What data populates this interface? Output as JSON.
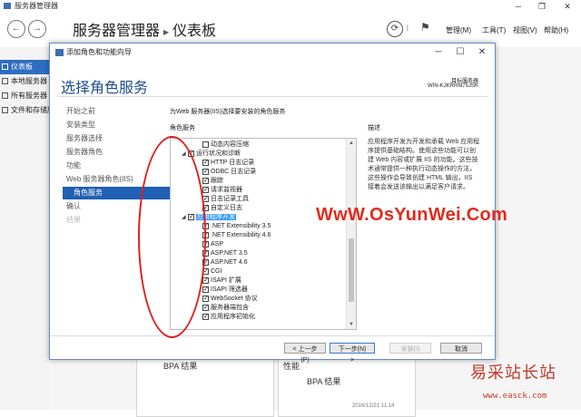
{
  "server_manager": {
    "window_title": "服务器管理器",
    "breadcrumb": {
      "app": "服务器管理器",
      "separator": "▸",
      "page": "仪表板"
    },
    "menus": {
      "manage": "管理(M)",
      "tools": "工具(T)",
      "view": "视图(V)",
      "help": "帮助(H)"
    },
    "nav": [
      "仪表板",
      "本地服务器",
      "所有服务器",
      "文件和存储服务"
    ],
    "tiles": {
      "left_bpa": "BPA 结果",
      "right_perf": "性能",
      "right_bpa": "BPA 结果",
      "timestamp": "2016/12/21 11:14"
    }
  },
  "wizard": {
    "title": "添加角色和功能向导",
    "heading": "选择角色服务",
    "dest_label": "目标服务器",
    "dest_server": "WIN-KJKRRM75JSK",
    "steps": [
      {
        "label": "开始之前",
        "state": "normal"
      },
      {
        "label": "安装类型",
        "state": "normal"
      },
      {
        "label": "服务器选择",
        "state": "normal"
      },
      {
        "label": "服务器角色",
        "state": "normal"
      },
      {
        "label": "功能",
        "state": "normal"
      },
      {
        "label": "Web 服务器角色(IIS)",
        "state": "normal"
      },
      {
        "label": "角色服务",
        "state": "active"
      },
      {
        "label": "确认",
        "state": "normal"
      },
      {
        "label": "结果",
        "state": "dim"
      }
    ],
    "intro": "为Web 服务器(IIS)选择要安装的角色服务",
    "roles_label": "角色服务",
    "desc_title": "描述",
    "description": "应用程序开发为开发和承载 Web 应用程序提供基础结构。使用这些功能可以创建 Web 内容或扩展 IIS 的功能。这些技术通常提供一种执行动态操作的方法，这些操作会导致创建 HTML 输出，IIS 接着会发送该输出以满足客户请求。",
    "tree": [
      {
        "label": "动态内容压缩",
        "level": 2,
        "checked": false,
        "expander": ""
      },
      {
        "label": "运行状况和诊断",
        "level": 1,
        "checked": true,
        "expander": "◢"
      },
      {
        "label": "HTTP 日志记录",
        "level": 2,
        "checked": true,
        "expander": ""
      },
      {
        "label": "ODBC 日志记录",
        "level": 2,
        "checked": true,
        "expander": ""
      },
      {
        "label": "跟踪",
        "level": 2,
        "checked": true,
        "expander": ""
      },
      {
        "label": "请求监视器",
        "level": 2,
        "checked": true,
        "expander": ""
      },
      {
        "label": "日志记录工具",
        "level": 2,
        "checked": true,
        "expander": ""
      },
      {
        "label": "自定义日志",
        "level": 2,
        "checked": true,
        "expander": ""
      },
      {
        "label": "应用程序开发",
        "level": 1,
        "checked": true,
        "expander": "◢",
        "highlight": true
      },
      {
        "label": ".NET Extensibility 3.5",
        "level": 2,
        "checked": true,
        "expander": ""
      },
      {
        "label": ".NET Extensibility 4.6",
        "level": 2,
        "checked": true,
        "expander": ""
      },
      {
        "label": "ASP",
        "level": 2,
        "checked": true,
        "expander": ""
      },
      {
        "label": "ASP.NET 3.5",
        "level": 2,
        "checked": true,
        "expander": ""
      },
      {
        "label": "ASP.NET 4.6",
        "level": 2,
        "checked": true,
        "expander": ""
      },
      {
        "label": "CGI",
        "level": 2,
        "checked": true,
        "expander": ""
      },
      {
        "label": "ISAPI 扩展",
        "level": 2,
        "checked": true,
        "expander": ""
      },
      {
        "label": "ISAPI 筛选器",
        "level": 2,
        "checked": true,
        "expander": ""
      },
      {
        "label": "WebSocket 协议",
        "level": 2,
        "checked": true,
        "expander": ""
      },
      {
        "label": "服务器端包含",
        "level": 2,
        "checked": true,
        "expander": ""
      },
      {
        "label": "应用程序初始化",
        "level": 2,
        "checked": true,
        "expander": ""
      }
    ],
    "buttons": {
      "prev": "< 上一步(P)",
      "next": "下一步(N) >",
      "install": "安装(I)",
      "cancel": "取消"
    }
  },
  "watermarks": {
    "main": "WwW.OsYunWei.Com",
    "cn": "易采站长站",
    "url": "www.easck.com"
  },
  "colors": {
    "accent": "#1f5fb4",
    "annotation": "#e01e1e",
    "watermark": "#e22b1c"
  }
}
